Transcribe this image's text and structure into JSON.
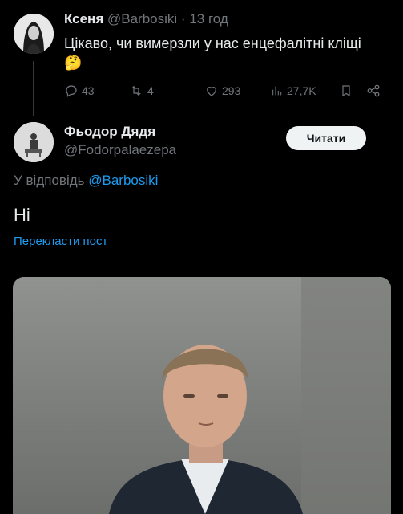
{
  "original_tweet": {
    "author_name": "Ксеня",
    "handle": "@Barbosiki",
    "separator": "·",
    "time": "13 год",
    "text": "Цікаво, чи вимерзли у нас енцефалітні кліщі",
    "emoji": "🤔",
    "actions": {
      "replies": "43",
      "retweets": "4",
      "likes": "293",
      "views": "27,7K"
    }
  },
  "reply": {
    "author_name": "Фьодор Дядя",
    "handle": "@Fodorpalaezepa",
    "follow_label": "Читати",
    "reply_to_prefix": "У відповідь",
    "reply_to_handle": "@Barbosiki",
    "text": "Ні",
    "translate_label": "Перекласти пост"
  },
  "colors": {
    "background": "#000000",
    "text": "#e7e9ea",
    "muted": "#71767b",
    "accent": "#1d9bf0"
  },
  "icons": [
    "reply-icon",
    "retweet-icon",
    "like-icon",
    "views-icon",
    "bookmark-icon",
    "share-icon"
  ]
}
